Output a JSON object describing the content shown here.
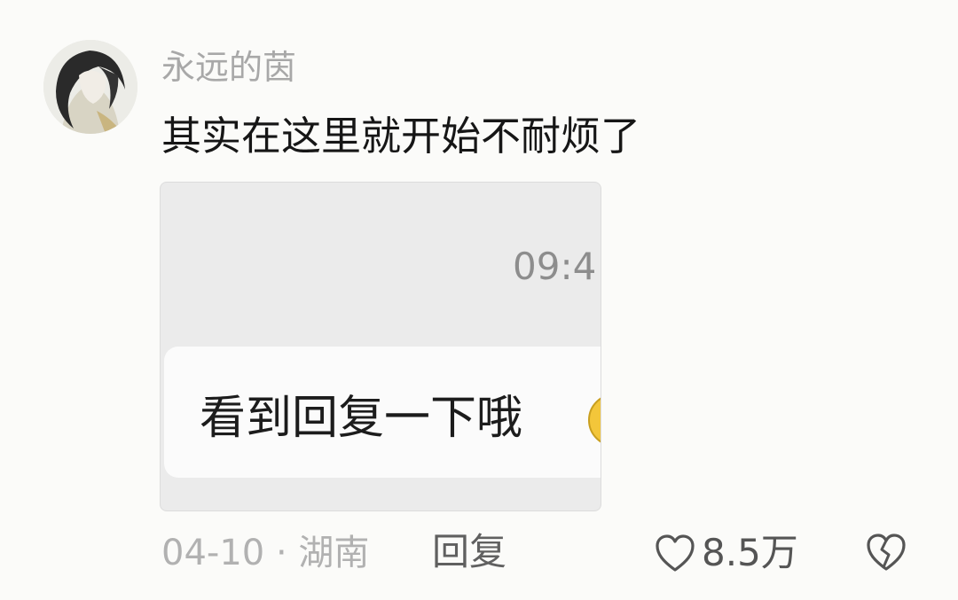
{
  "comment": {
    "username": "永远的茵",
    "text": "其实在这里就开始不耐烦了",
    "avatar_icon": "user-avatar",
    "attachment": {
      "time": "09:4",
      "bubble_text": "看到回复一下哦",
      "emoji_icon": "emoji-icon"
    },
    "footer": {
      "date_location": "04-10 · 湖南",
      "reply_label": "回复",
      "like_count": "8.5万",
      "like_icon": "heart-outline-icon",
      "dislike_icon": "broken-heart-icon"
    }
  }
}
